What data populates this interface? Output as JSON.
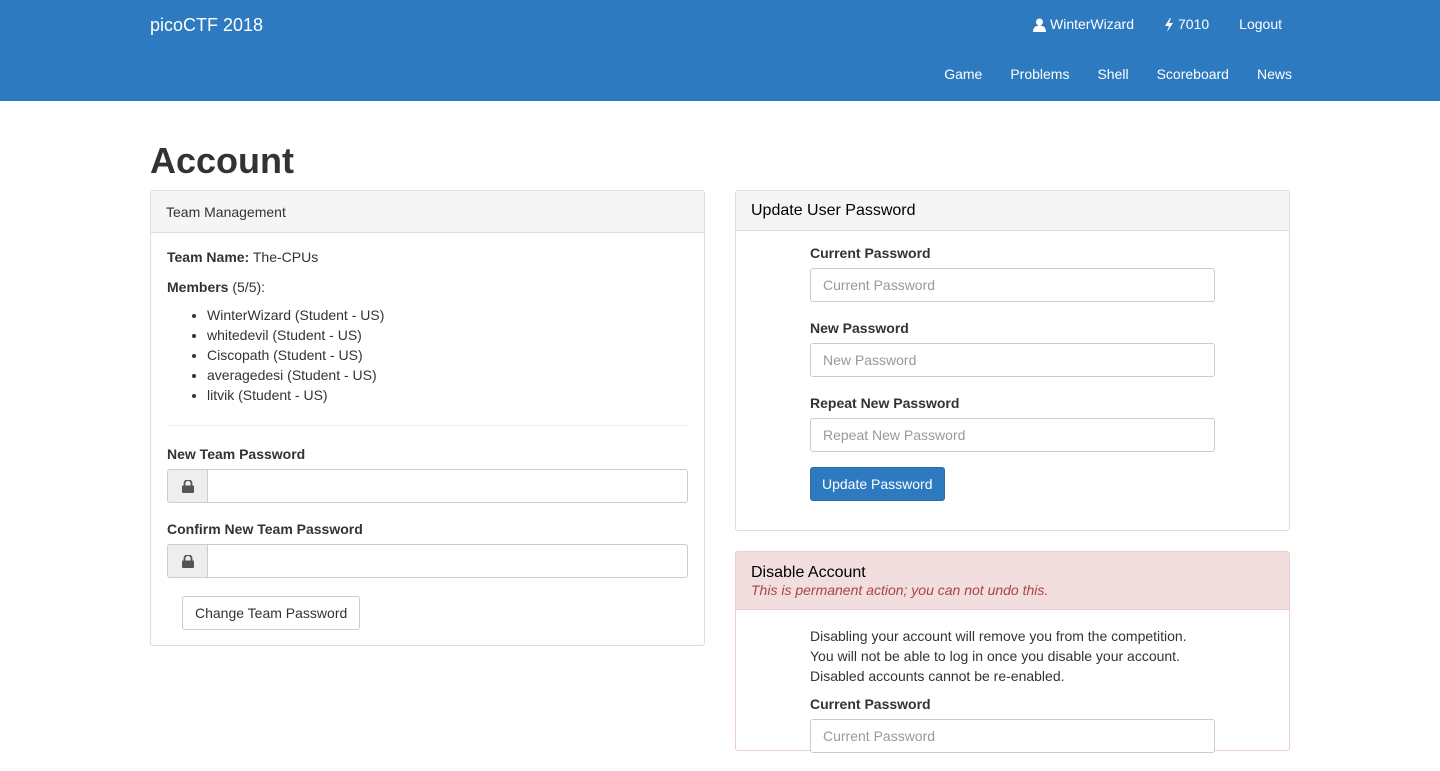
{
  "navbar": {
    "brand": "picoCTF 2018",
    "user": {
      "icon": "user-icon",
      "name": "WinterWizard"
    },
    "score": {
      "icon": "bolt-icon",
      "value": "7010"
    },
    "logout": "Logout",
    "links": [
      "Game",
      "Problems",
      "Shell",
      "Scoreboard",
      "News"
    ]
  },
  "page": {
    "title": "Account"
  },
  "team": {
    "heading": "Team Management",
    "name_label": "Team Name:",
    "name_value": "The-CPUs",
    "members_label": "Members",
    "members_count": "(5/5):",
    "members": [
      "WinterWizard (Student - US)",
      "whitedevil (Student - US)",
      "Ciscopath (Student - US)",
      "averagedesi (Student - US)",
      "litvik (Student - US)"
    ],
    "new_password_label": "New Team Password",
    "confirm_password_label": "Confirm New Team Password",
    "change_button": "Change Team Password"
  },
  "password": {
    "heading": "Update User Password",
    "current_label": "Current Password",
    "current_placeholder": "Current Password",
    "new_label": "New Password",
    "new_placeholder": "New Password",
    "repeat_label": "Repeat New Password",
    "repeat_placeholder": "Repeat New Password",
    "update_button": "Update Password"
  },
  "disable": {
    "heading": "Disable Account",
    "warning": "This is permanent action; you can not undo this.",
    "description": [
      "Disabling your account will remove you from the competition.",
      "You will not be able to log in once you disable your account.",
      "Disabled accounts cannot be re-enabled."
    ],
    "current_label": "Current Password",
    "current_placeholder": "Current Password"
  },
  "colors": {
    "navbar": "#2d7ac0",
    "primary_button": "#2d7ac0",
    "danger_heading_bg": "#f2dede",
    "danger_text": "#a94442"
  }
}
